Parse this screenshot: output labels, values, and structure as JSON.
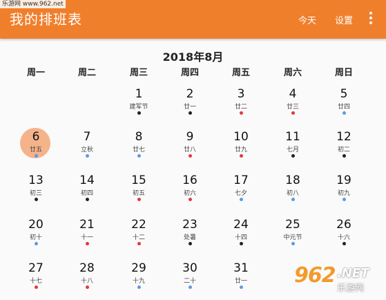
{
  "watermark_top": "乐游网 www.962.net",
  "app_bar": {
    "title": "我的排班表",
    "today_label": "今天",
    "settings_label": "设置",
    "more_icon": "more-vert-icon"
  },
  "calendar": {
    "month_title": "2018年8月",
    "weekdays": [
      "周一",
      "周二",
      "周三",
      "周四",
      "周五",
      "周六",
      "周日"
    ],
    "selected_day": 6,
    "first_weekday_index": 2,
    "colors": {
      "red": "#e53935",
      "blue": "#5b9be0",
      "black": "#222222",
      "accent": "#f07f2c",
      "selection": "#f5b38a"
    },
    "days": [
      {
        "day": "1",
        "lunar": "建军节",
        "dot": "black"
      },
      {
        "day": "2",
        "lunar": "廿一",
        "dot": "black"
      },
      {
        "day": "3",
        "lunar": "廿二",
        "dot": "red"
      },
      {
        "day": "4",
        "lunar": "廿三",
        "dot": "red"
      },
      {
        "day": "5",
        "lunar": "廿四",
        "dot": "blue"
      },
      {
        "day": "6",
        "lunar": "廿五",
        "dot": "blue"
      },
      {
        "day": "7",
        "lunar": "立秋",
        "dot": "blue"
      },
      {
        "day": "8",
        "lunar": "廿七",
        "dot": "blue"
      },
      {
        "day": "9",
        "lunar": "廿八",
        "dot": "red"
      },
      {
        "day": "10",
        "lunar": "廿九",
        "dot": "red"
      },
      {
        "day": "11",
        "lunar": "七月",
        "dot": "black"
      },
      {
        "day": "12",
        "lunar": "初二",
        "dot": "black"
      },
      {
        "day": "13",
        "lunar": "初三",
        "dot": "black"
      },
      {
        "day": "14",
        "lunar": "初四",
        "dot": "black"
      },
      {
        "day": "15",
        "lunar": "初五",
        "dot": "red"
      },
      {
        "day": "16",
        "lunar": "初六",
        "dot": "red"
      },
      {
        "day": "17",
        "lunar": "七夕",
        "dot": "blue"
      },
      {
        "day": "18",
        "lunar": "初八",
        "dot": "blue"
      },
      {
        "day": "19",
        "lunar": "初九",
        "dot": "blue"
      },
      {
        "day": "20",
        "lunar": "初十",
        "dot": "blue"
      },
      {
        "day": "21",
        "lunar": "十一",
        "dot": "red"
      },
      {
        "day": "22",
        "lunar": "十二",
        "dot": "red"
      },
      {
        "day": "23",
        "lunar": "处暑",
        "dot": "black"
      },
      {
        "day": "24",
        "lunar": "十四",
        "dot": "black"
      },
      {
        "day": "25",
        "lunar": "中元节",
        "dot": "blue"
      },
      {
        "day": "26",
        "lunar": "十六",
        "dot": "black"
      },
      {
        "day": "27",
        "lunar": "十七",
        "dot": "red"
      },
      {
        "day": "28",
        "lunar": "十八",
        "dot": "red"
      },
      {
        "day": "29",
        "lunar": "十九",
        "dot": "blue"
      },
      {
        "day": "30",
        "lunar": "二十",
        "dot": "blue"
      },
      {
        "day": "31",
        "lunar": "廿一",
        "dot": "blue"
      }
    ]
  },
  "logo_watermark": {
    "number": "962",
    ".net": ".NET",
    "sub": "乐游网"
  }
}
